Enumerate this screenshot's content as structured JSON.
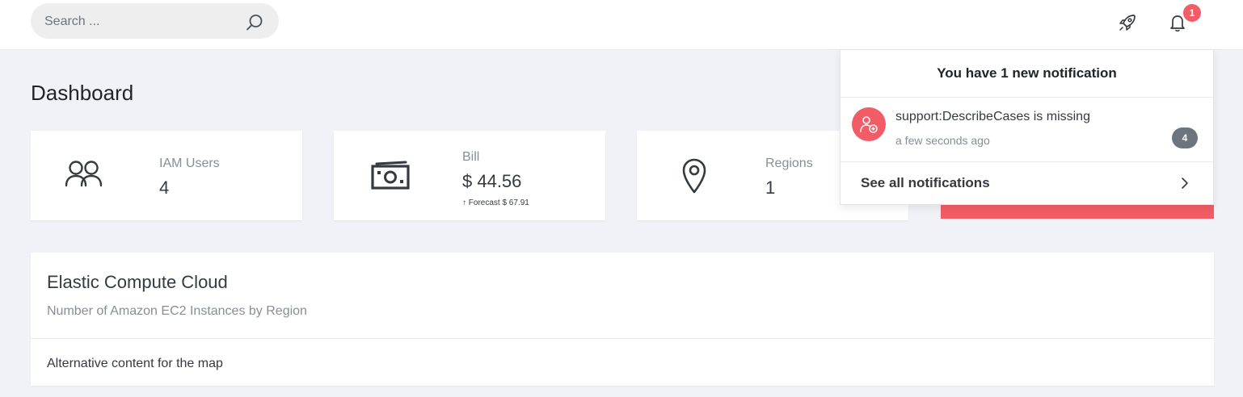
{
  "search": {
    "placeholder": "Search ..."
  },
  "header": {
    "notification_badge": "1"
  },
  "page": {
    "title": "Dashboard"
  },
  "stats": [
    {
      "label": "IAM Users",
      "value": "4",
      "icon": "users-icon"
    },
    {
      "label": "Bill",
      "value": "$ 44.56",
      "forecast": "↑ Forecast $ 67.91",
      "icon": "money-icon"
    },
    {
      "label": "Regions",
      "value": "1",
      "icon": "map-pin-icon"
    }
  ],
  "ec2": {
    "title": "Elastic Compute Cloud",
    "subtitle": "Number of Amazon EC2 Instances by Region",
    "map_alt": "Alternative content for the map"
  },
  "notifications": {
    "header": "You have 1 new notification",
    "items": [
      {
        "message": "support:DescribeCases is missing",
        "time": "a few seconds ago",
        "count": "4",
        "icon": "user-plus-icon"
      }
    ],
    "footer": "See all notifications"
  },
  "colors": {
    "accent": "#f25c66",
    "background": "#f1f2f7",
    "badge_gray": "#6c757d"
  }
}
